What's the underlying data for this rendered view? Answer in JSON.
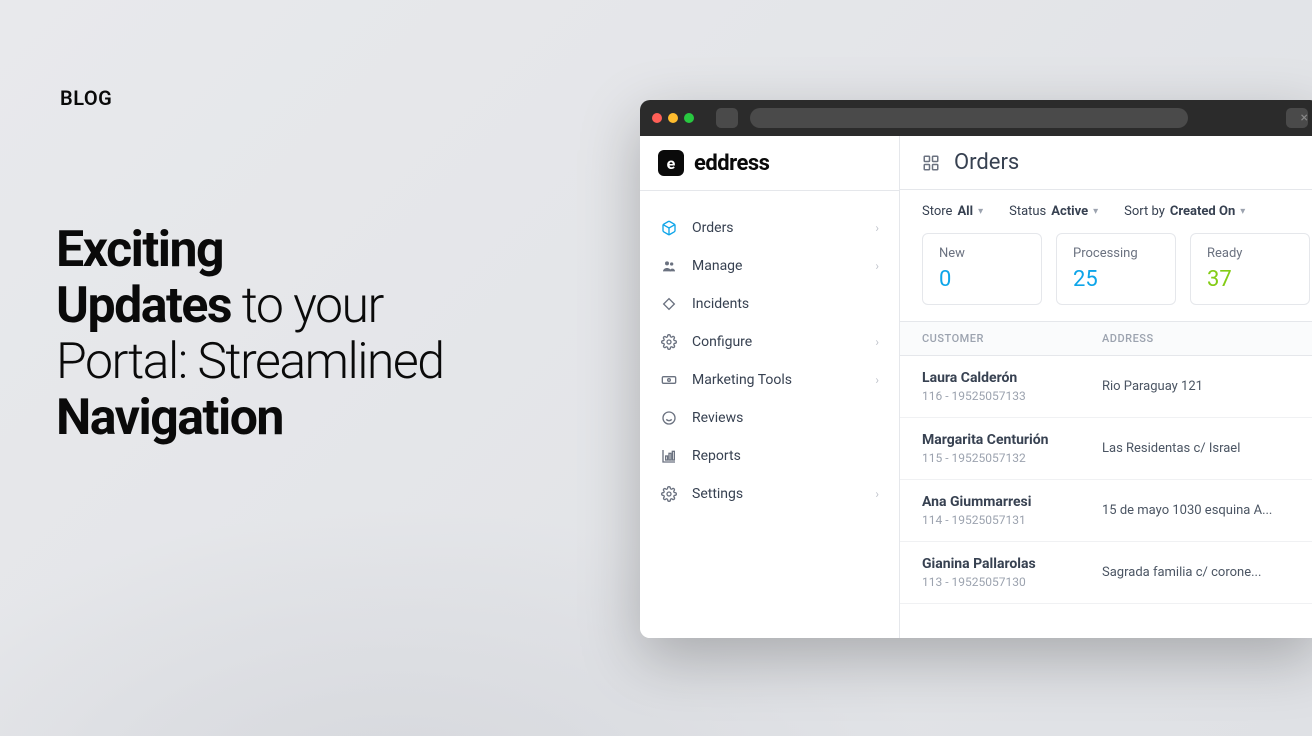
{
  "page_label": "BLOG",
  "headline": {
    "line1_bold": "Exciting",
    "line2_bold": "Updates",
    "line2_rest": " to your",
    "line3": "Portal: Streamlined",
    "line4_bold": "Navigation"
  },
  "brand": {
    "logo_letter": "e",
    "name": "eddress"
  },
  "nav": [
    {
      "label": "Orders",
      "icon": "cube",
      "chevron": true,
      "active": true
    },
    {
      "label": "Manage",
      "icon": "users",
      "chevron": true
    },
    {
      "label": "Incidents",
      "icon": "tag",
      "chevron": false
    },
    {
      "label": "Configure",
      "icon": "gear",
      "chevron": true
    },
    {
      "label": "Marketing Tools",
      "icon": "cash",
      "chevron": true
    },
    {
      "label": "Reviews",
      "icon": "smile",
      "chevron": false
    },
    {
      "label": "Reports",
      "icon": "chart",
      "chevron": false
    },
    {
      "label": "Settings",
      "icon": "gear",
      "chevron": true
    }
  ],
  "main": {
    "title": "Orders",
    "filters": {
      "store_label": "Store",
      "store_value": "All",
      "status_label": "Status",
      "status_value": "Active",
      "sort_label": "Sort by",
      "sort_value": "Created On"
    },
    "cards": [
      {
        "label": "New",
        "value": "0",
        "kind": "new"
      },
      {
        "label": "Processing",
        "value": "25",
        "kind": "processing"
      },
      {
        "label": "Ready",
        "value": "37",
        "kind": "ready"
      }
    ],
    "columns": {
      "customer": "CUSTOMER",
      "address": "ADDRESS"
    },
    "rows": [
      {
        "name": "Laura Calderón",
        "sub": "116 - 19525057133",
        "address": "Rio Paraguay 121"
      },
      {
        "name": "Margarita Centurión",
        "sub": "115 - 19525057132",
        "address": "Las Residentas c/ Israel"
      },
      {
        "name": "Ana Giummarresi",
        "sub": "114 - 19525057131",
        "address": "15 de mayo 1030 esquina A..."
      },
      {
        "name": "Gianina Pallarolas",
        "sub": "113 - 19525057130",
        "address": "Sagrada familia c/ corone..."
      }
    ]
  }
}
